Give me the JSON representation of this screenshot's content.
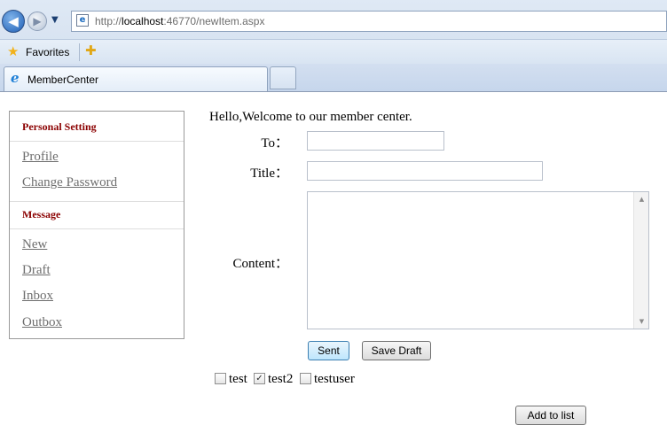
{
  "browser": {
    "url_prefix": "http://",
    "url_host": "localhost",
    "url_rest": ":46770/newItem.aspx",
    "favorites_label": "Favorites",
    "tab_title": "MemberCenter"
  },
  "sidebar": {
    "sections": [
      {
        "title": "Personal Setting",
        "links": [
          "Profile",
          "Change Password"
        ]
      },
      {
        "title": "Message",
        "links": [
          "New",
          "Draft",
          "Inbox",
          "Outbox"
        ]
      }
    ]
  },
  "main": {
    "welcome": "Hello,Welcome to our member center.",
    "to_label": "To：",
    "to_value": "",
    "title_label": "Title：",
    "title_value": "",
    "content_label": "Content：",
    "content_value": "",
    "sent_button": "Sent",
    "save_draft_button": "Save Draft",
    "recipients": [
      {
        "label": "test",
        "checked": false
      },
      {
        "label": "test2",
        "checked": true
      },
      {
        "label": "testuser",
        "checked": false
      }
    ],
    "add_to_list_button": "Add to list"
  }
}
